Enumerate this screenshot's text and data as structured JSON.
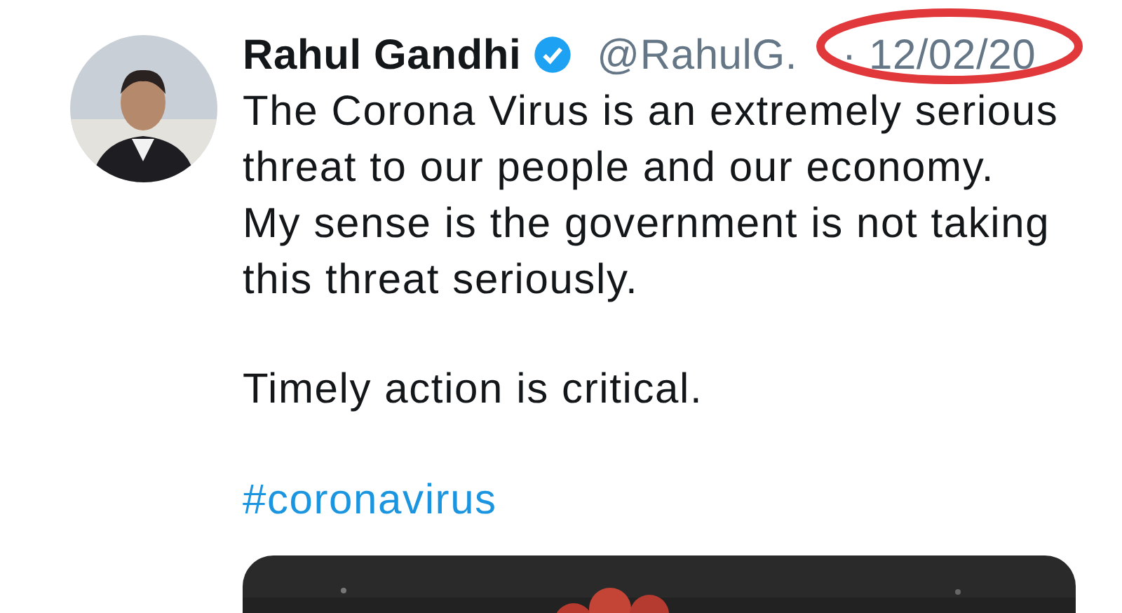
{
  "tweet": {
    "author": "Rahul Gandhi",
    "verified": true,
    "handle": "@RahulG.",
    "time": "· 12/02/20",
    "time_circled": true,
    "paragraphs": [
      "The Corona Virus is an extremely serious threat to our people and our economy.\nMy sense is the government is not taking this threat seriously.",
      "Timely action is critical."
    ],
    "hashtag": "#coronavirus"
  }
}
